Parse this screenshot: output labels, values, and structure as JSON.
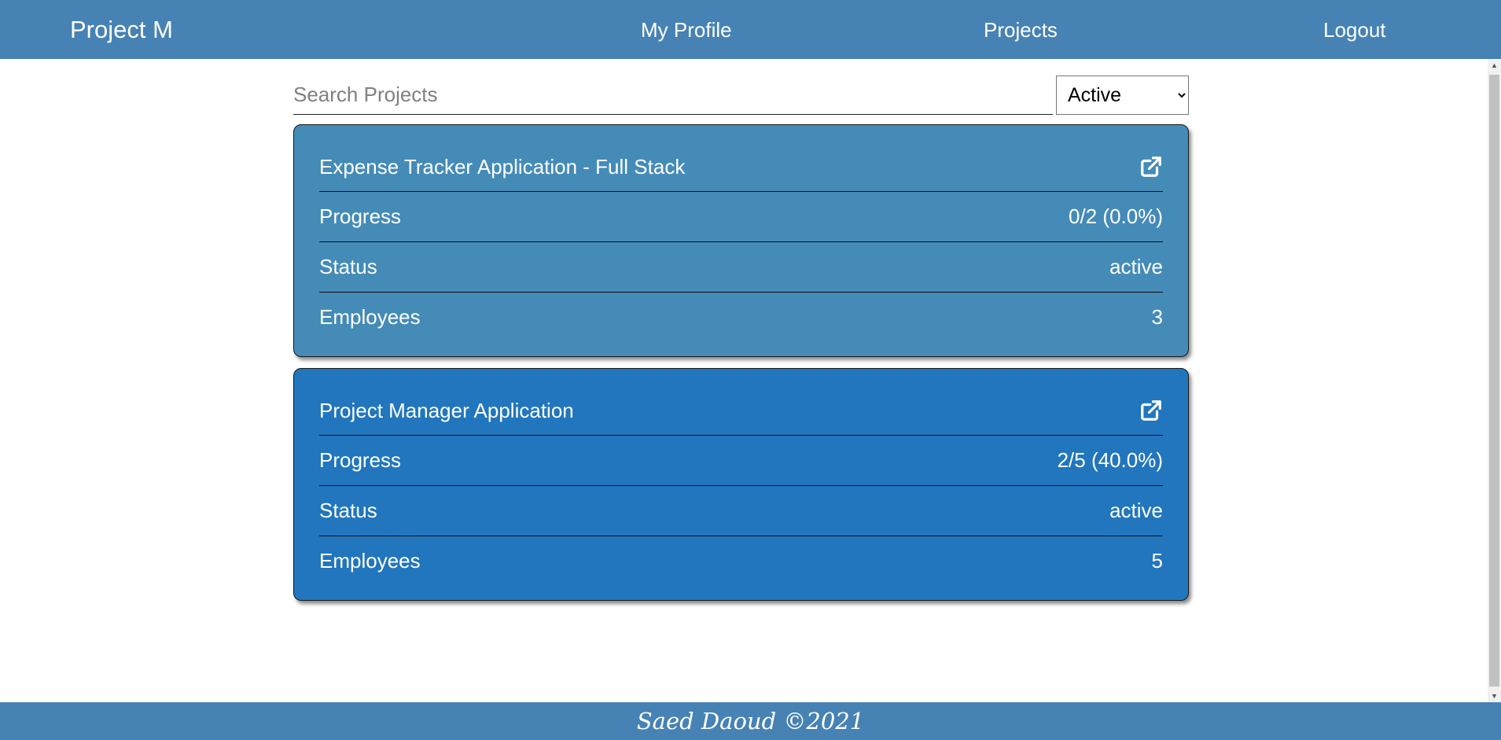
{
  "header": {
    "brand": "Project M",
    "nav": {
      "profile": "My Profile",
      "projects": "Projects",
      "logout": "Logout"
    }
  },
  "search": {
    "placeholder": "Search Projects",
    "value": ""
  },
  "filter": {
    "selected": "Active"
  },
  "colors": {
    "header": "#4682b4",
    "card_1": "#448bb8",
    "card_2": "#2176bd"
  },
  "projects": [
    {
      "title": "Expense Tracker Application - Full Stack",
      "icon": "external-link-icon",
      "progress_label": "Progress",
      "progress_value": "0/2 (0.0%)",
      "status_label": "Status",
      "status_value": "active",
      "employees_label": "Employees",
      "employees_value": "3"
    },
    {
      "title": "Project Manager Application",
      "icon": "external-link-icon",
      "progress_label": "Progress",
      "progress_value": "2/5 (40.0%)",
      "status_label": "Status",
      "status_value": "active",
      "employees_label": "Employees",
      "employees_value": "5"
    }
  ],
  "footer": {
    "text": "Saed Daoud ©2021"
  }
}
